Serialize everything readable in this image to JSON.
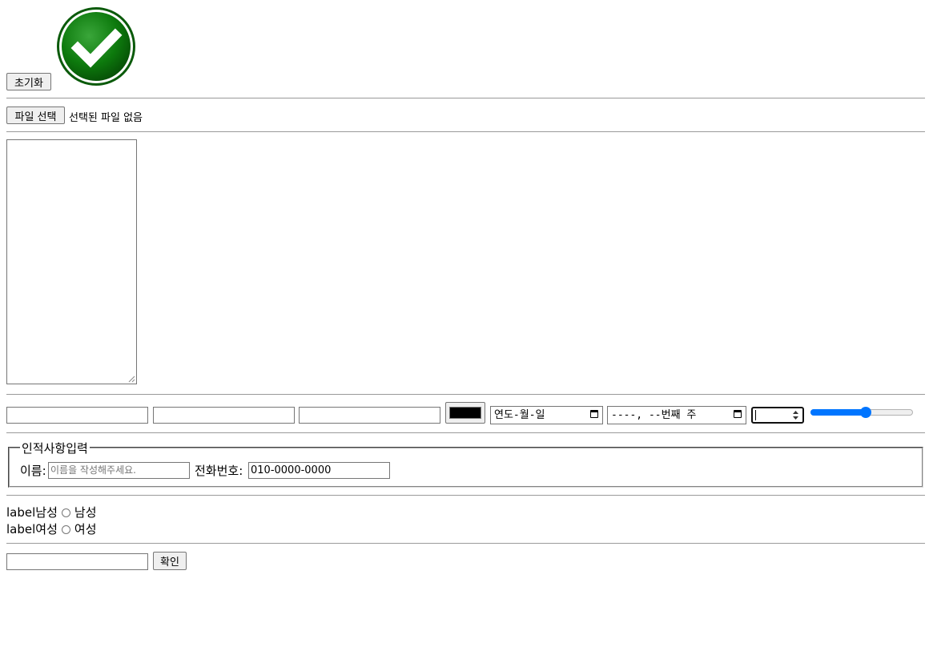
{
  "reset_button": {
    "label": "초기화"
  },
  "file": {
    "button_label": "파일 선택",
    "status": "선택된 파일 없음"
  },
  "inputs": {
    "date_placeholder": "연도-월-일",
    "week_placeholder": "----, --번째 주",
    "color_value": "#000000",
    "range_fraction": 0.5
  },
  "fieldset": {
    "legend": "인적사항입력",
    "name_label": "이름:",
    "name_placeholder": "이름을 작성해주세요.",
    "phone_label": "전화번호:",
    "phone_value": "010-0000-0000"
  },
  "gender": {
    "male_prefix": "label남성",
    "male_label": "남성",
    "female_prefix": "label여성",
    "female_label": "여성"
  },
  "submit": {
    "label": "확인"
  }
}
